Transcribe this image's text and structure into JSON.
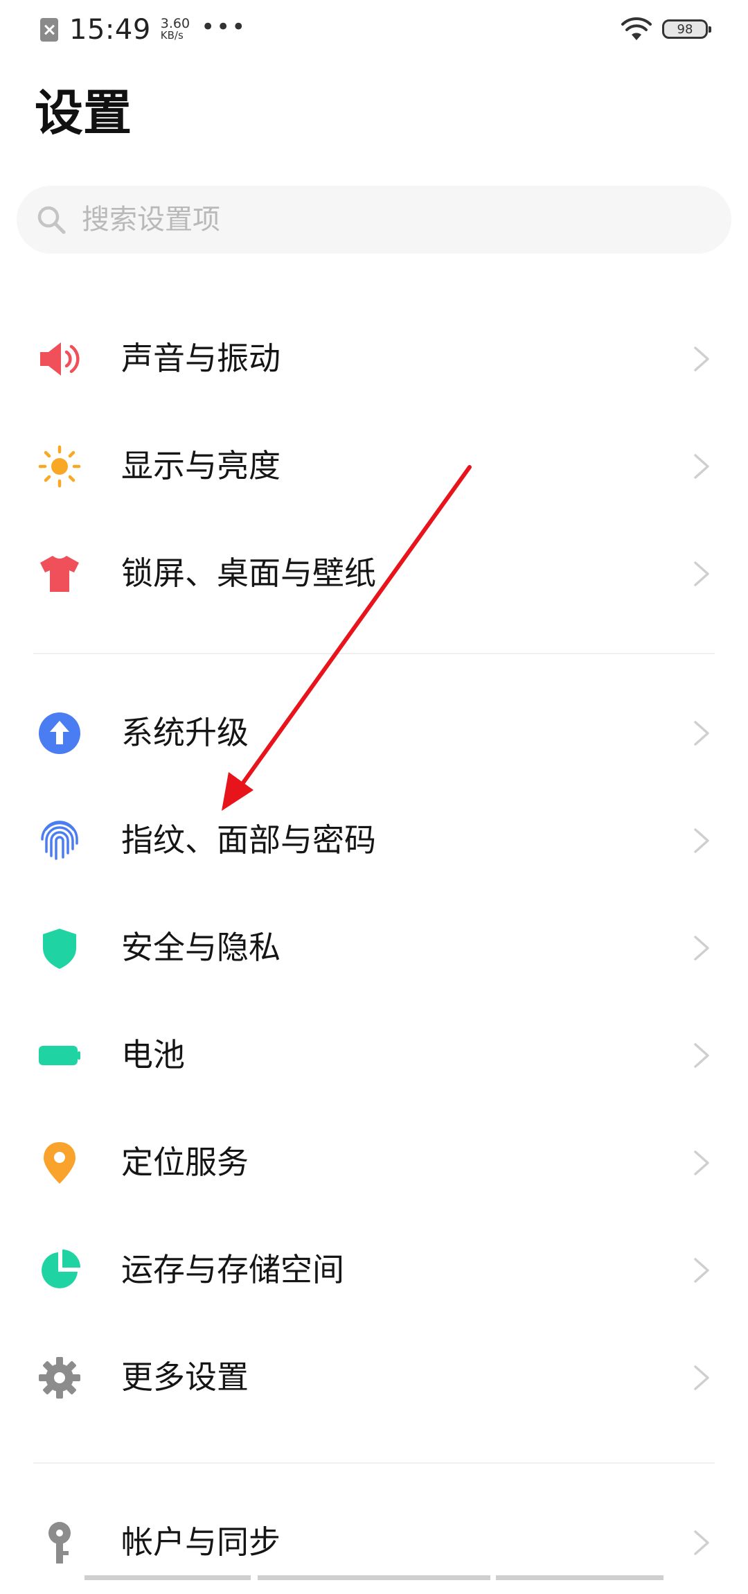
{
  "status_bar": {
    "time": "15:49",
    "net_speed_value": "3.60",
    "net_speed_unit": "KB/s",
    "more": "•••",
    "battery": "98"
  },
  "header": {
    "title": "设置"
  },
  "search": {
    "placeholder": "搜索设置项"
  },
  "settings": {
    "items": [
      {
        "label": "声音与振动",
        "icon": "speaker-icon"
      },
      {
        "label": "显示与亮度",
        "icon": "sun-icon"
      },
      {
        "label": "锁屏、桌面与壁纸",
        "icon": "tshirt-icon"
      },
      {
        "label": "系统升级",
        "icon": "upgrade-arrow-icon"
      },
      {
        "label": "指纹、面部与密码",
        "icon": "fingerprint-icon"
      },
      {
        "label": "安全与隐私",
        "icon": "shield-icon"
      },
      {
        "label": "电池",
        "icon": "battery-icon"
      },
      {
        "label": "定位服务",
        "icon": "location-pin-icon"
      },
      {
        "label": "运存与存储空间",
        "icon": "pie-chart-icon"
      },
      {
        "label": "更多设置",
        "icon": "gear-icon"
      },
      {
        "label": "帐户与同步",
        "icon": "key-icon"
      }
    ]
  },
  "colors": {
    "sound": "#f0505a",
    "display": "#f9a825",
    "wallpaper": "#f0505a",
    "upgrade": "#4a7cf2",
    "fingerprint": "#4a7cf2",
    "security": "#1fd3a3",
    "battery": "#1fd3a3",
    "location": "#f9a32c",
    "storage": "#1fd3a3",
    "more": "#8c8c8c",
    "account": "#8c8c8c",
    "annotation_arrow": "#e8141c"
  }
}
